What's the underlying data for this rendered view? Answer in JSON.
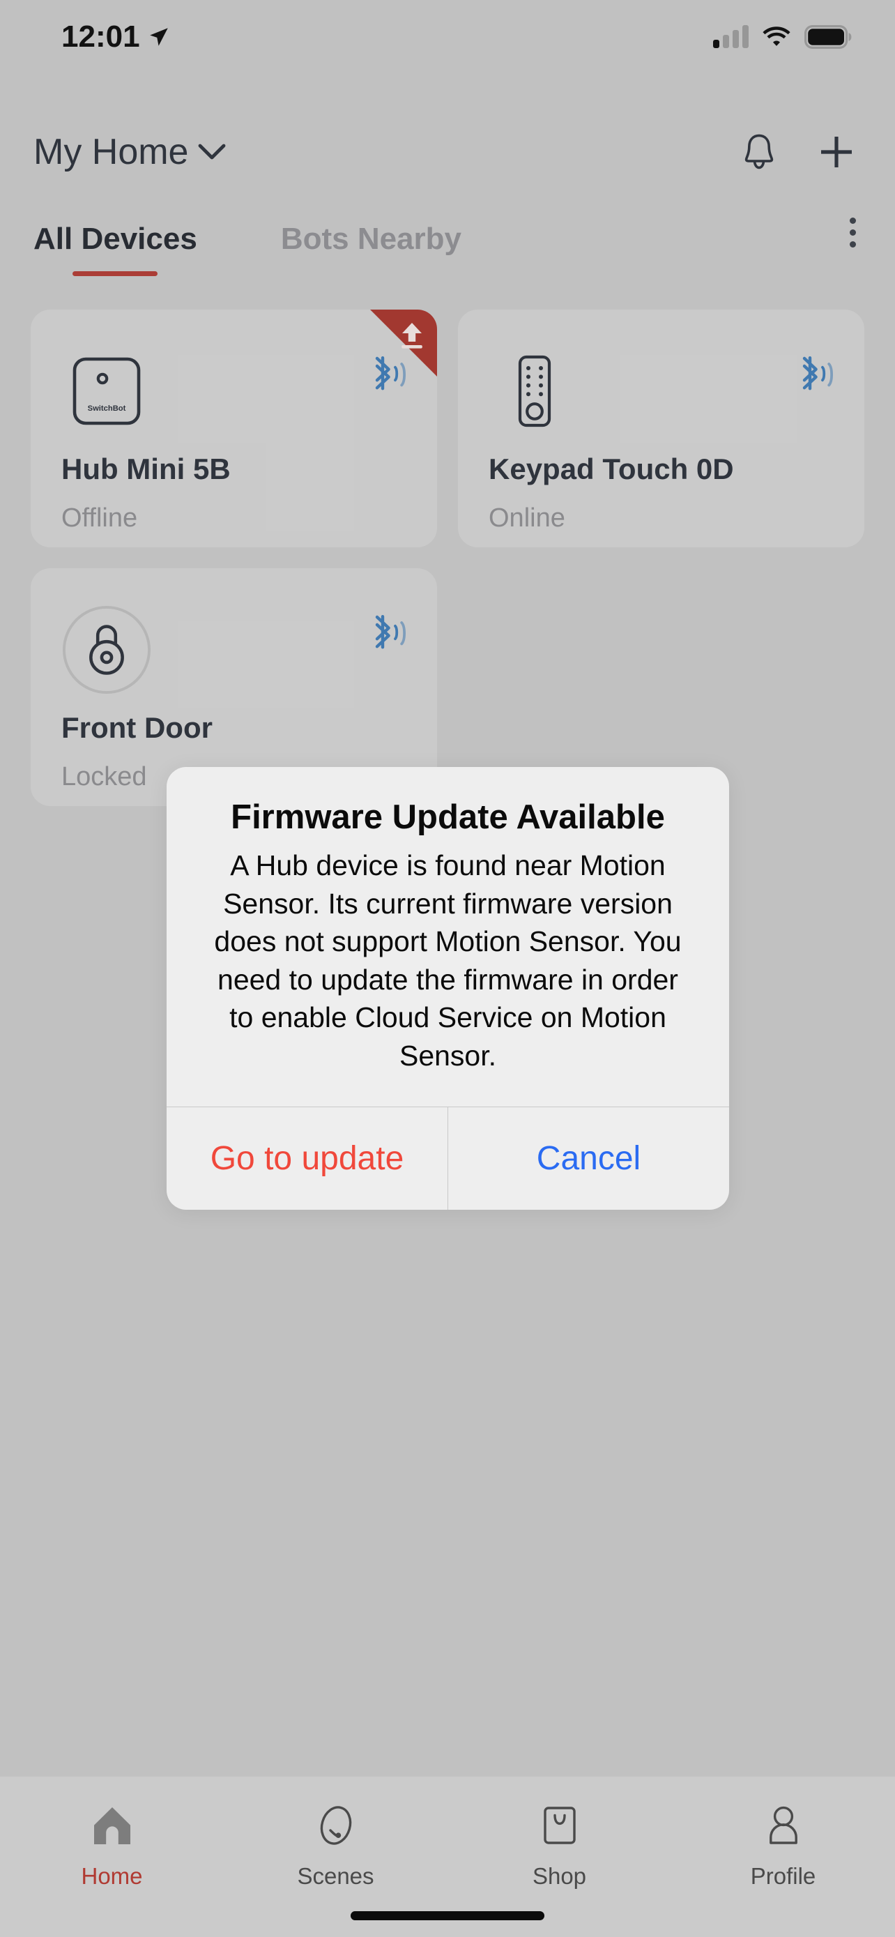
{
  "status_bar": {
    "time": "12:01",
    "location_icon": "location-arrow-icon",
    "cellular_icon": "cellular-bars-icon",
    "cellular_bars_active": 1,
    "wifi_icon": "wifi-icon",
    "battery_icon": "battery-full-icon"
  },
  "header": {
    "home_name": "My Home",
    "chevron_icon": "chevron-down-icon",
    "bell_icon": "bell-icon",
    "add_icon": "plus-icon"
  },
  "tabs": {
    "items": [
      {
        "label": "All Devices",
        "active": true
      },
      {
        "label": "Bots Nearby",
        "active": false
      }
    ],
    "overflow_icon": "more-vertical-icon",
    "indicator_color": "#b03a32"
  },
  "devices": [
    {
      "name": "Hub Mini 5B",
      "status": "Offline",
      "icon": "hub-mini-icon",
      "brand_text": "SwitchBot",
      "bluetooth": true,
      "update_badge": true,
      "badge_icon": "firmware-upload-icon"
    },
    {
      "name": "Keypad Touch 0D",
      "status": "Online",
      "icon": "keypad-touch-icon",
      "bluetooth": true,
      "update_badge": false
    },
    {
      "name": "Front Door",
      "status": "Locked",
      "icon": "padlock-icon",
      "bluetooth": true,
      "update_badge": false
    }
  ],
  "dialog": {
    "title": "Firmware Update Available",
    "message": "A Hub device is found near Motion Sensor. Its current firmware version does not support Motion Sensor. You need to update the firmware in order to enable Cloud Service on Motion Sensor.",
    "primary_label": "Go to update",
    "primary_color": "#f0483b",
    "secondary_label": "Cancel",
    "secondary_color": "#2a6bf2"
  },
  "bottom_nav": {
    "items": [
      {
        "label": "Home",
        "icon": "home-icon",
        "active": true
      },
      {
        "label": "Scenes",
        "icon": "scenes-icon",
        "active": false
      },
      {
        "label": "Shop",
        "icon": "shop-bag-icon",
        "active": false
      },
      {
        "label": "Profile",
        "icon": "person-icon",
        "active": false
      }
    ],
    "active_color": "#b03a32"
  },
  "colors": {
    "page_background": "#c7c7c7",
    "card_background": "#d1d1d1",
    "dialog_background": "#eeeeee",
    "bluetooth": "#3d7ab5",
    "badge_red": "#a6342c"
  }
}
